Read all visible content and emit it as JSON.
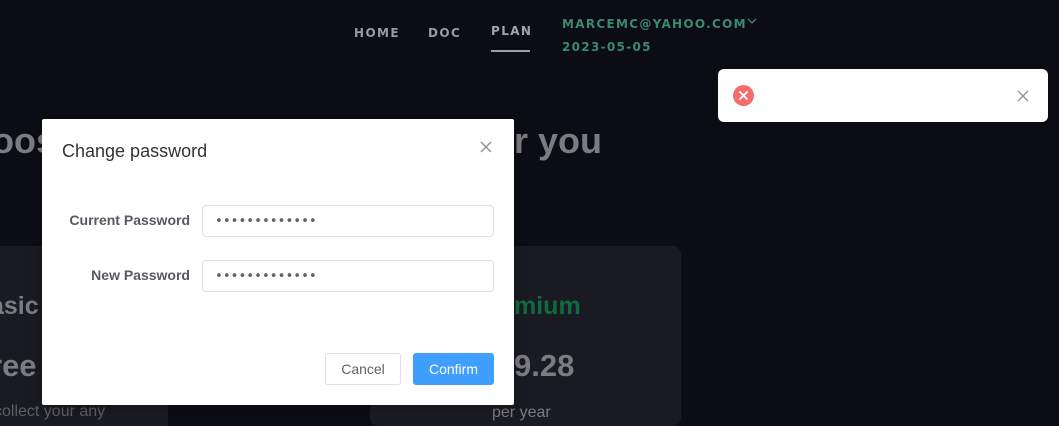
{
  "nav": {
    "home": "HOME",
    "doc": "DOC",
    "plan": "PLAN"
  },
  "user": {
    "email": "MARCEMC@YAHOO.COM",
    "date": "2023-05-05"
  },
  "background": {
    "hero_left": "oos",
    "hero_right": "r you",
    "basic_title": "asic",
    "basic_price": "ree",
    "basic_desc": "collect your any",
    "premium_title": "mium",
    "premium_price": "9.28",
    "premium_period": "per year"
  },
  "modal": {
    "title": "Change password",
    "current_label": "Current Password",
    "current_value": "•••••••••••••",
    "new_label": "New Password",
    "new_value": "•••••••••••••",
    "cancel_label": "Cancel",
    "confirm_label": "Confirm"
  },
  "notification": {
    "message": ""
  },
  "colors": {
    "background": "#0c0c14",
    "accent_green": "#3a8a6c",
    "premium_green": "#0f6b3e",
    "primary_button": "#409eff",
    "error_icon": "#f56c6c"
  },
  "icons": {
    "user_menu": "chevron-down-icon",
    "modal_close": "close-icon",
    "notification_status": "error-circle-icon",
    "notification_close": "close-icon"
  }
}
